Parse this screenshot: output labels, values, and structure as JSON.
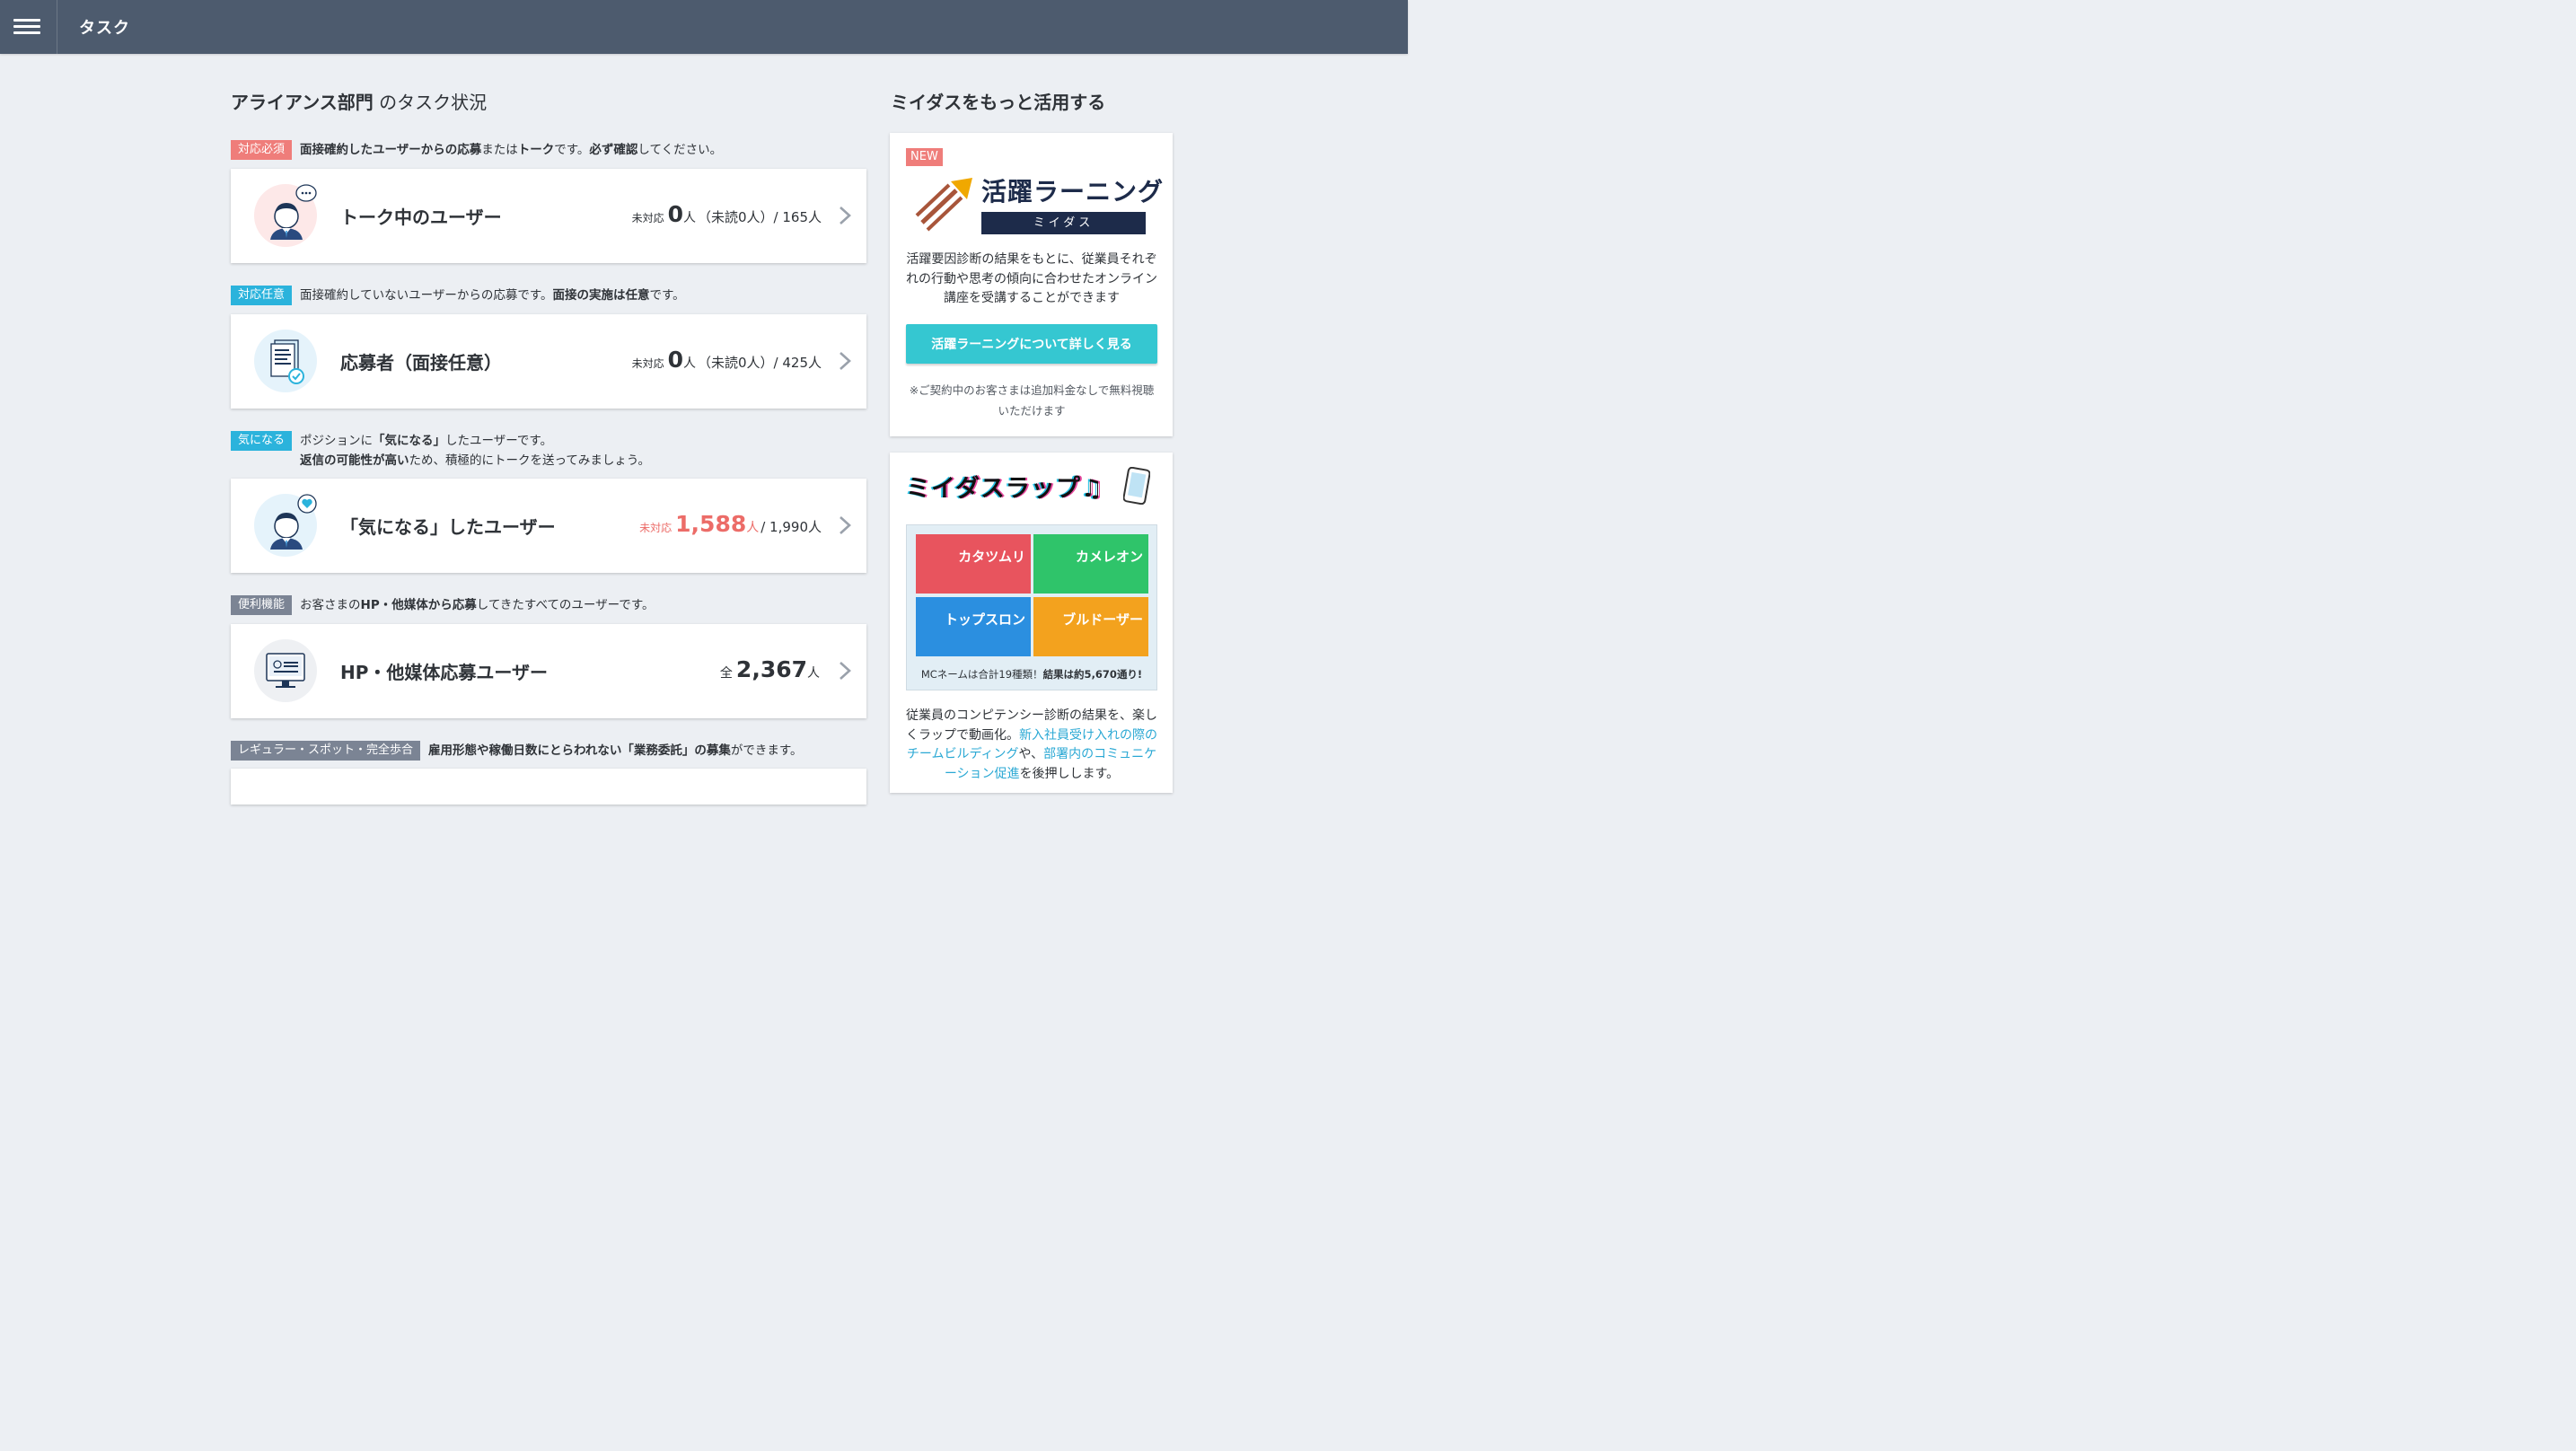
{
  "header": {
    "title": "タスク"
  },
  "main": {
    "title_bold": "アライアンス部門",
    "title_rest": " のタスク状況",
    "sections": [
      {
        "tag": "対応必須",
        "desc_parts": [
          "面接確約したユーザーからの応募",
          "または",
          "トーク",
          "です。",
          "必ず確認",
          "してください。"
        ],
        "card_label": "トーク中のユーザー",
        "count_prefix": "未対応",
        "count_value": "0",
        "count_unit": "人",
        "count_suffix": "（未読0人）/ 165人"
      },
      {
        "tag": "対応任意",
        "desc_parts": [
          "面接確約していないユーザーからの応募です。",
          "面接の実施は任意",
          "です。"
        ],
        "card_label": "応募者（面接任意）",
        "count_prefix": "未対応",
        "count_value": "0",
        "count_unit": "人",
        "count_suffix": "（未読0人）/ 425人"
      },
      {
        "tag": "気になる",
        "desc_line1_parts": [
          "ポジションに",
          "「気になる」",
          "したユーザーです。"
        ],
        "desc_line2_parts": [
          "返信の可能性が高い",
          "ため、積極的にトークを送ってみましょう。"
        ],
        "card_label": "「気になる」したユーザー",
        "count_prefix": "未対応",
        "count_value": "1,588",
        "count_unit": "人",
        "count_suffix": " / 1,990人"
      },
      {
        "tag": "便利機能",
        "desc_parts": [
          "お客さまの",
          "HP・他媒体から応募",
          "してきたすべてのユーザーです。"
        ],
        "card_label": "HP・他媒体応募ユーザー",
        "count_prefix": "全",
        "count_value": "2,367",
        "count_unit": "人"
      },
      {
        "tag": "レギュラー・スポット・完全歩合",
        "desc_parts": [
          "雇用形態や稼働日数にとらわれない",
          "「業務委託」の募集",
          "ができます。"
        ]
      }
    ]
  },
  "sidebar": {
    "title": "ミイダスをもっと活用する",
    "learning": {
      "badge": "NEW",
      "logo_main": "活躍ラーニング",
      "logo_sub": "ミイダス",
      "desc": "活躍要因診断の結果をもとに、従業員それぞれの行動や思考の傾向に合わせたオンライン講座を受講することができます",
      "button": "活躍ラーニングについて詳しく見る",
      "note": "※ご契約中のお客さまは追加料金なしで無料視聴いただけます"
    },
    "rap": {
      "logo": "ミイダスラップ♫",
      "cards": [
        {
          "mc": "カタツムリ",
          "bg": "#e8545e"
        },
        {
          "mc": "カメレオン",
          "bg": "#2fc46a"
        },
        {
          "mc": "トップスロン",
          "bg": "#2b8fe0"
        },
        {
          "mc": "ブルドーザー",
          "bg": "#f3a21e"
        }
      ],
      "caption_plain": "MCネームは合計19種類！",
      "caption_bold": "結果は約5,670通り!",
      "desc_parts": [
        "従業員のコンピテンシー診断の結果を、楽しくラップで動画化。",
        "新入社員受け入れの際のチームビルディング",
        "や、",
        "部署内のコミュニケーション促進",
        "を後押しします。"
      ]
    }
  },
  "colors": {
    "topbar": "#4d5b6e",
    "tag_red": "#ef7d7a",
    "tag_blue": "#2bb3dc",
    "tag_gray": "#7b8494",
    "hot": "#ec6c68",
    "button": "#35c7d1"
  }
}
